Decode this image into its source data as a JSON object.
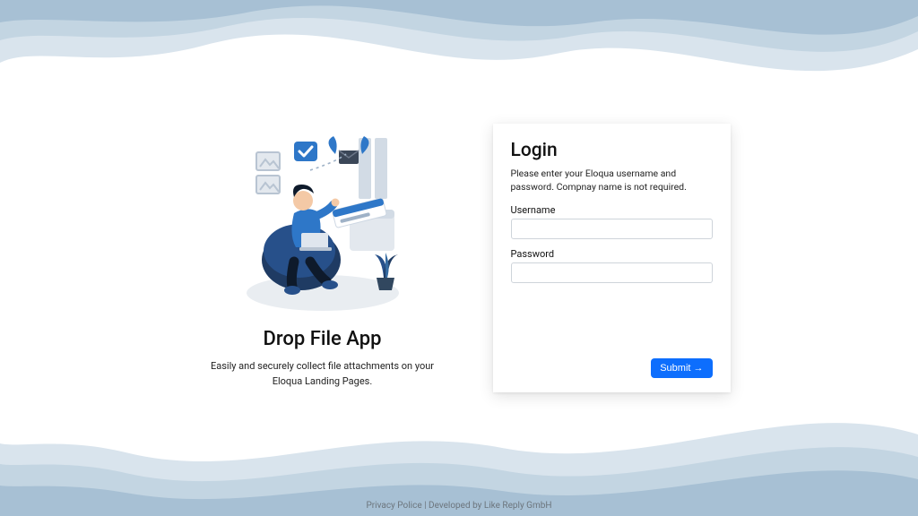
{
  "left": {
    "title": "Drop File App",
    "subtitle": "Easily and securely collect file attachments on your Eloqua Landing Pages."
  },
  "login": {
    "heading": "Login",
    "hint": "Please enter your Eloqua username and password. Compnay name is not required.",
    "username_label": "Username",
    "username_value": "",
    "password_label": "Password",
    "password_value": "",
    "submit_label": "Submit →"
  },
  "footer": {
    "privacy": "Privacy Police",
    "sep": " | ",
    "dev": "Developed by Like Reply GmbH"
  },
  "colors": {
    "wave_light": "#d9e4ed",
    "wave_mid": "#c3d5e2",
    "wave_dark": "#a7c0d4",
    "accent": "#0d6efd"
  }
}
